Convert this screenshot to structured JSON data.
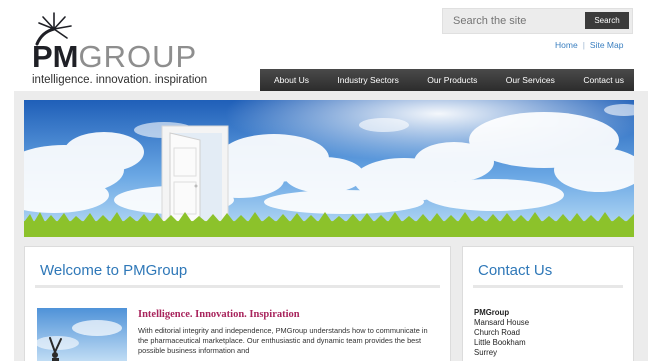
{
  "logo": {
    "name_bold": "PM",
    "name_light": "GROUP",
    "tagline": "intelligence. innovation. inspiration"
  },
  "search": {
    "placeholder": "Search the site",
    "button_label": "Search"
  },
  "util_links": {
    "home": "Home",
    "sitemap": "Site Map"
  },
  "nav": {
    "items": [
      {
        "label": "About Us"
      },
      {
        "label": "Industry Sectors"
      },
      {
        "label": "Our Products"
      },
      {
        "label": "Our Services"
      },
      {
        "label": "Contact us"
      }
    ]
  },
  "welcome": {
    "heading": "Welcome to PMGroup",
    "subheading": "Intelligence. Innovation. Inspiration",
    "body": "With editorial integrity and independence, PMGroup understands how to communicate in the pharmaceutical marketplace. Our enthusiastic and dynamic team provides the best possible business information and"
  },
  "contact": {
    "heading": "Contact Us",
    "company": "PMGroup",
    "address_lines": [
      "Mansard House",
      "Church Road",
      "Little Bookham",
      "Surrey"
    ]
  },
  "colors": {
    "heading_blue": "#2f78b8",
    "subheading_magenta": "#a8245c",
    "nav_dark": "#383838",
    "link_blue": "#3a7fc0"
  },
  "icons": {
    "logo_star": "starburst-icon"
  }
}
